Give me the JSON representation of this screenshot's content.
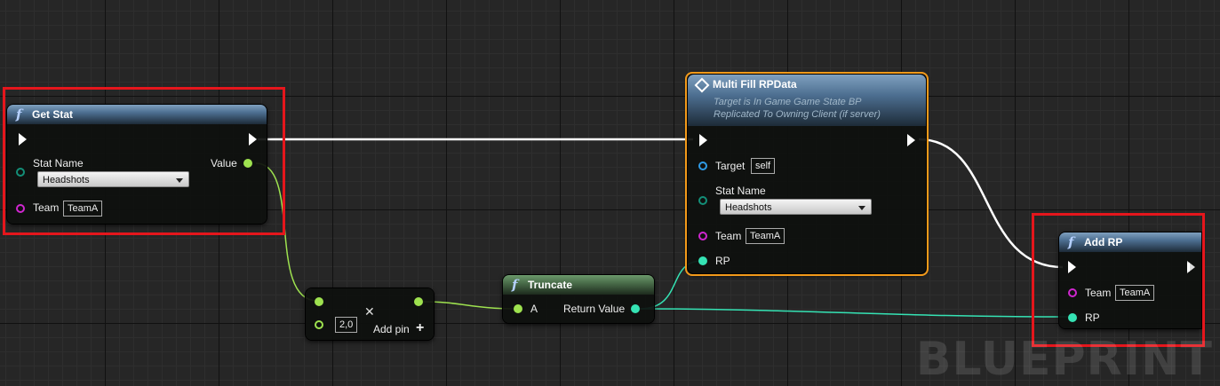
{
  "watermark": "BLUEPRINT",
  "colors": {
    "exec": "#ffffff",
    "float_pin": "#9ee24f",
    "integer_pin": "#35e3b4",
    "enum_pin": "#138f78",
    "string_pin": "#d026d0",
    "object_pin": "#2f9be7",
    "highlight": "#e5161c",
    "selected": "#f39a1a"
  },
  "get_stat": {
    "title": "Get Stat",
    "icon": "function-icon",
    "stat_name_label": "Stat Name",
    "stat_name_value": "Headshots",
    "team_label": "Team",
    "team_value": "TeamA",
    "output_label": "Value"
  },
  "multiply": {
    "operand_value": "2,0",
    "add_pin_label": "Add pin"
  },
  "truncate": {
    "title": "Truncate",
    "input_label": "A",
    "output_label": "Return Value"
  },
  "multi_fill": {
    "title": "Multi Fill RPData",
    "subtitle_line1": "Target is In Game Game State BP",
    "subtitle_line2": "Replicated To Owning Client (if server)",
    "target_label": "Target",
    "target_value": "self",
    "stat_name_label": "Stat Name",
    "stat_name_value": "Headshots",
    "team_label": "Team",
    "team_value": "TeamA",
    "rp_label": "RP"
  },
  "add_rp": {
    "title": "Add RP",
    "team_label": "Team",
    "team_value": "TeamA",
    "rp_label": "RP"
  }
}
